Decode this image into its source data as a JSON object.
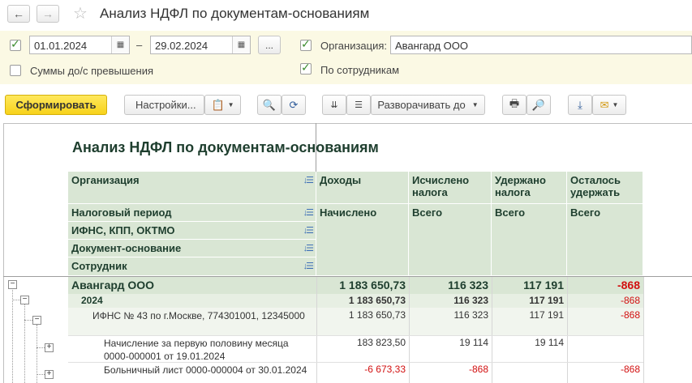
{
  "window": {
    "title": "Анализ НДФЛ по документам-основаниям"
  },
  "filters": {
    "date_from": "01.01.2024",
    "date_to": "29.02.2024",
    "dash": "–",
    "dots": "...",
    "organization_label": "Организация:",
    "organization_value": "Авангард ООО",
    "over_limit_label": "Суммы до/с превышения",
    "by_employees_label": "По сотрудникам"
  },
  "toolbar": {
    "generate_label": "Сформировать",
    "settings_label": "Настройки...",
    "expand_label": "Разворачивать до"
  },
  "report": {
    "title": "Анализ НДФЛ по документам-основаниям",
    "groupings": [
      "Организация",
      "Налоговый период",
      "ИФНС, КПП, ОКТМО",
      "Документ-основание",
      "Сотрудник"
    ],
    "col_headers": [
      {
        "top": "Доходы",
        "bottom": "Начислено"
      },
      {
        "top": "Исчислено налога",
        "bottom": "Всего"
      },
      {
        "top": "Удержано налога",
        "bottom": "Всего"
      },
      {
        "top": "Осталось удержать",
        "bottom": "Всего"
      }
    ],
    "rows": [
      {
        "name": "Авангард ООО",
        "income": "1 183 650,73",
        "calculated": "116 323",
        "withheld": "117 191",
        "remaining": "-868"
      },
      {
        "name": "2024",
        "income": "1 183 650,73",
        "calculated": "116 323",
        "withheld": "117 191",
        "remaining": "-868"
      },
      {
        "name": "ИФНС № 43 по г.Москве, 774301001, 12345000",
        "income": "1 183 650,73",
        "calculated": "116 323",
        "withheld": "117 191",
        "remaining": "-868"
      },
      {
        "name": "Начисление за первую половину месяца 0000-000001 от 19.01.2024",
        "income": "183 823,50",
        "calculated": "19 114",
        "withheld": "19 114",
        "remaining": ""
      },
      {
        "name": "Больничный лист 0000-000004 от 30.01.2024",
        "income": "-6 673,33",
        "calculated": "-868",
        "withheld": "",
        "remaining": "-868"
      }
    ]
  }
}
